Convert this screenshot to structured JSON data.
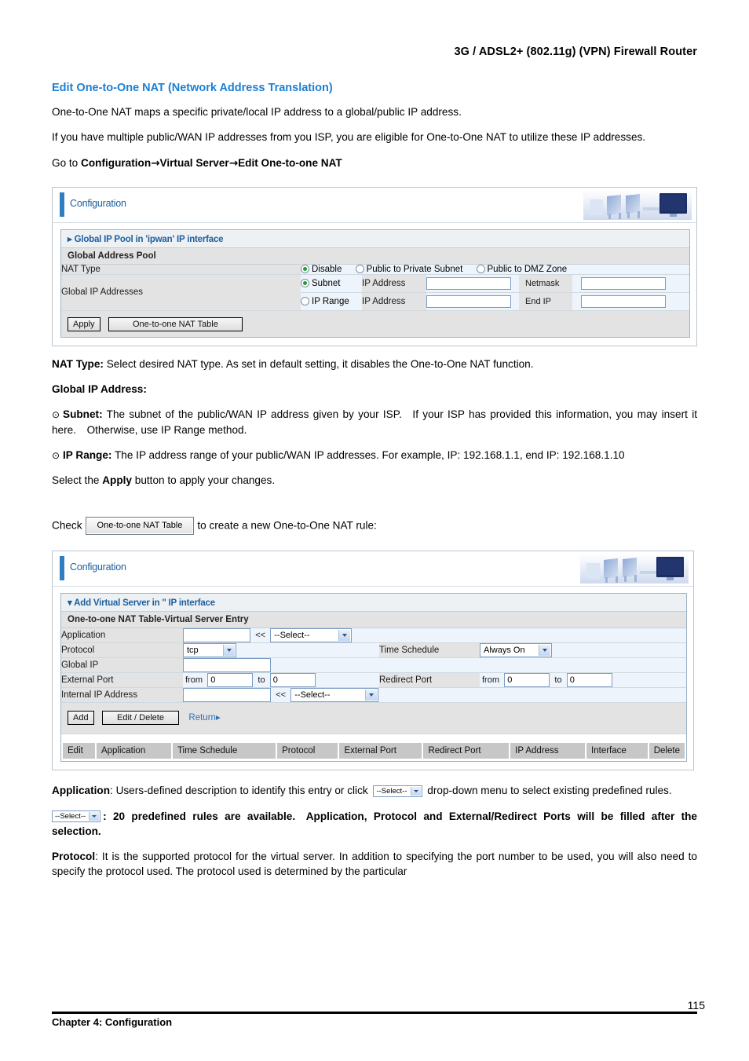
{
  "header": {
    "running_title": "3G / ADSL2+ (802.11g) (VPN) Firewall Router"
  },
  "section": {
    "title": "Edit One-to-One NAT (Network Address Translation)",
    "paragraph_1": "One-to-One NAT maps a specific private/local IP address to a global/public IP address.",
    "paragraph_2": "If you have multiple public/WAN IP addresses from you ISP, you are eligible for One-to-One NAT to utilize these IP addresses.",
    "goto_prefix": "Go to ",
    "goto_path_1": "Configuration",
    "goto_arrow": "→",
    "goto_path_2": "Virtual Server",
    "goto_path_3": "Edit One-to-one NAT"
  },
  "panel1": {
    "titlebar": "Configuration",
    "section_header": "Global IP Pool in 'ipwan' IP interface",
    "group_header": "Global Address Pool",
    "nat_type_label": "NAT Type",
    "nat_type_options": [
      {
        "label": "Disable",
        "selected": true
      },
      {
        "label": "Public to Private Subnet",
        "selected": false
      },
      {
        "label": "Public to DMZ Zone",
        "selected": false
      }
    ],
    "global_ip_label": "Global IP Addresses",
    "rows": [
      {
        "radio_label": "Subnet",
        "selected": true,
        "field1_label": "IP Address",
        "field1_value": "",
        "field2_label": "Netmask",
        "field2_value": ""
      },
      {
        "radio_label": "IP Range",
        "selected": false,
        "field1_label": "IP Address",
        "field1_value": "",
        "field2_label": "End IP",
        "field2_value": ""
      }
    ],
    "buttons": [
      {
        "label": "Apply"
      },
      {
        "label": "One-to-one NAT Table"
      }
    ]
  },
  "desc1": {
    "nat_type_term": "NAT Type:",
    "nat_type_text": " Select desired NAT type. As set in default setting, it disables the One-to-One NAT function.",
    "global_ip_term": "Global IP Address:",
    "bullet_glyph": "⊙",
    "subnet_term": "Subnet:",
    "subnet_text": " The subnet of the public/WAN IP address given by your ISP. If your ISP has provided this information, you may insert it here. Otherwise, use IP Range method.",
    "iprange_term": "IP Range:",
    "iprange_text": " The IP address range of your public/WAN IP addresses. For example, IP: 192.168.1.1, end IP: 192.168.1.10",
    "apply_sentence_pre": "Select the ",
    "apply_sentence_bold": "Apply",
    "apply_sentence_post": " button to apply your changes.",
    "check_pre": "Check",
    "check_button": "One-to-one NAT Table",
    "check_post": "to create a new One-to-One NAT rule:"
  },
  "panel2": {
    "titlebar": "Configuration",
    "section_header": "Add Virtual Server in '' IP interface",
    "group_header": "One-to-one NAT Table-Virtual Server Entry",
    "fields": {
      "application_label": "Application",
      "application_value": "",
      "application_arrows": "<<",
      "application_select": "--Select--",
      "protocol_label": "Protocol",
      "protocol_select": "tcp",
      "time_schedule_label": "Time Schedule",
      "time_schedule_select": "Always On",
      "global_ip_label": "Global IP",
      "global_ip_value": "",
      "external_port_label": "External Port",
      "external_from_label": "from",
      "external_from_value": "0",
      "external_to_label": "to",
      "external_to_value": "0",
      "redirect_port_label": "Redirect Port",
      "redirect_from_label": "from",
      "redirect_from_value": "0",
      "redirect_to_label": "to",
      "redirect_to_value": "0",
      "internal_ip_label": "Internal IP Address",
      "internal_ip_value": "",
      "internal_ip_arrows": "<<",
      "internal_ip_select": "--Select--"
    },
    "buttons": [
      {
        "label": "Add"
      },
      {
        "label": "Edit / Delete"
      }
    ],
    "return_link": "Return",
    "return_glyph": "▸",
    "grid_columns": [
      "Edit",
      "Application",
      "Time Schedule",
      "Protocol",
      "External Port",
      "Redirect Port",
      "IP Address",
      "Interface",
      "Delete"
    ]
  },
  "desc2": {
    "application_term": "Application",
    "application_text_1": ": Users-defined description to identify this entry or click ",
    "application_select_label": "--Select--",
    "application_text_2": " drop-down menu to select existing predefined rules.",
    "select_term_label": "--Select--",
    "select_text": ": 20 predefined rules are available. Application, Protocol and External/Redirect Ports will be filled after the selection.",
    "protocol_term": "Protocol",
    "protocol_text": ": It is the supported protocol for the virtual server. In addition to specifying the port number to be used, you will also need to specify the protocol used. The protocol used is determined by the particular"
  },
  "footer": {
    "chapter": "Chapter 4: Configuration",
    "page_number": "115"
  },
  "colors": {
    "heading_blue": "#1b7fd4",
    "ui_blue": "#1c5f9e",
    "accent_bar": "#2f7ec0",
    "label_gray": "#e3e3e3",
    "field_blue": "#eef4fb",
    "grid_header": "#c7c7c7"
  }
}
